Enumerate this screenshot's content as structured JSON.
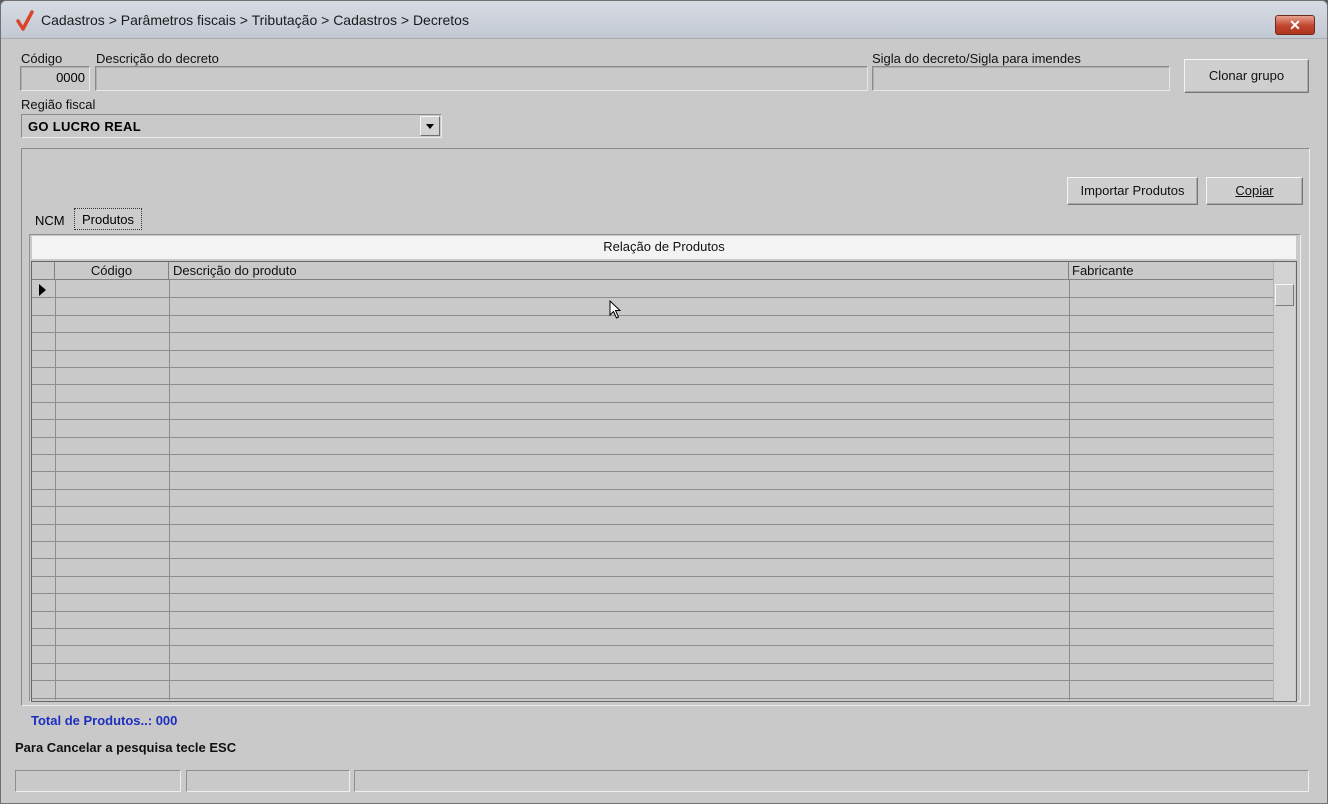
{
  "window": {
    "title": "Cadastros > Parâmetros fiscais > Tributação > Cadastros > Decretos",
    "close_label": "✕",
    "close_color": "#c0442c"
  },
  "form": {
    "codigo_label": "Código",
    "codigo_value": "0000",
    "descricao_label": "Descrição do decreto",
    "descricao_value": "",
    "sigla_label": "Sigla do decreto/Sigla para imendes",
    "sigla_value": "",
    "clonar_label": "Clonar grupo",
    "regiao_label": "Região fiscal",
    "regiao_value": "GO LUCRO REAL"
  },
  "actions": {
    "importar_label": "Importar Produtos",
    "copiar_label": "Copiar"
  },
  "tabs": [
    {
      "label": "NCM",
      "active": false
    },
    {
      "label": "Produtos",
      "active": true
    }
  ],
  "grid": {
    "title": "Relação de Produtos",
    "columns": [
      "Código",
      "Descrição do produto",
      "Fabricante"
    ],
    "rows": []
  },
  "footer": {
    "total_text": "Total de Produtos..: 000",
    "total_color": "#1c2fbf",
    "hint_text": "Para Cancelar a pesquisa tecle ESC"
  },
  "status_bar": [
    "",
    "",
    ""
  ]
}
